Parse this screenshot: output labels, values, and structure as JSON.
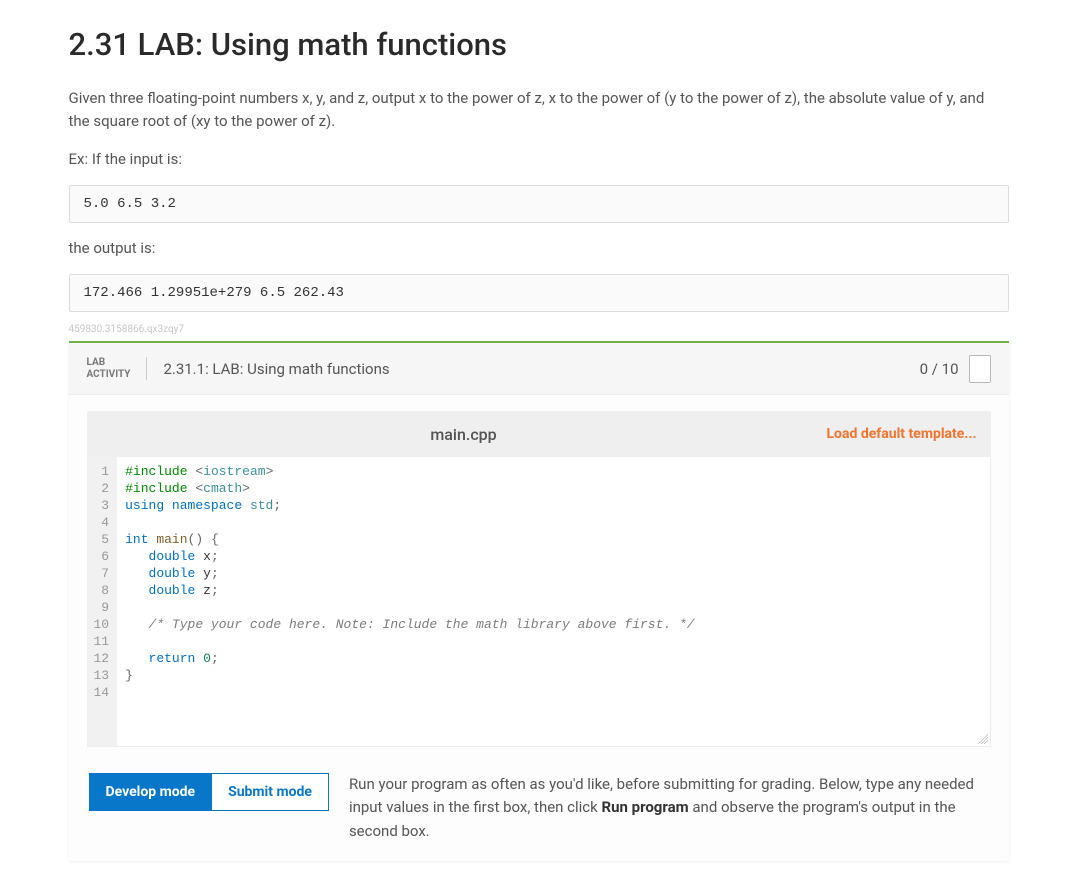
{
  "page": {
    "title": "2.31 LAB: Using math functions",
    "intro": "Given three floating-point numbers x, y, and z, output x to the power of z, x to the power of (y to the power of z), the absolute value of y, and the square root of (xy to the power of z).",
    "ex_label": "Ex: If the input is:",
    "ex_input": "5.0 6.5 3.2",
    "output_label": "the output is:",
    "ex_output": "172.466 1.29951e+279 6.5 262.43",
    "tiny_id": "459830.3158866.qx3zqy7"
  },
  "lab": {
    "activity_label_line1": "LAB",
    "activity_label_line2": "ACTIVITY",
    "title": "2.31.1: LAB: Using math functions",
    "score": "0 / 10",
    "filename": "main.cpp",
    "load_template": "Load default template...",
    "code_lines": [
      {
        "n": 1,
        "tokens": [
          [
            "kw-pre",
            "#include "
          ],
          [
            "punct",
            "<"
          ],
          [
            "id-ns",
            "iostream"
          ],
          [
            "punct",
            ">"
          ]
        ]
      },
      {
        "n": 2,
        "tokens": [
          [
            "kw-pre",
            "#include "
          ],
          [
            "punct",
            "<"
          ],
          [
            "id-ns",
            "cmath"
          ],
          [
            "punct",
            ">"
          ]
        ]
      },
      {
        "n": 3,
        "tokens": [
          [
            "kw",
            "using "
          ],
          [
            "kw2",
            "namespace "
          ],
          [
            "id-ns",
            "std"
          ],
          [
            "punct",
            ";"
          ]
        ]
      },
      {
        "n": 4,
        "tokens": []
      },
      {
        "n": 5,
        "tokens": [
          [
            "kw",
            "int "
          ],
          [
            "fn",
            "main"
          ],
          [
            "punct",
            "() {"
          ]
        ]
      },
      {
        "n": 6,
        "tokens": [
          [
            "",
            "   "
          ],
          [
            "type",
            "double "
          ],
          [
            "",
            "x"
          ],
          [
            "punct",
            ";"
          ]
        ]
      },
      {
        "n": 7,
        "tokens": [
          [
            "",
            "   "
          ],
          [
            "type",
            "double "
          ],
          [
            "",
            "y"
          ],
          [
            "punct",
            ";"
          ]
        ]
      },
      {
        "n": 8,
        "tokens": [
          [
            "",
            "   "
          ],
          [
            "type",
            "double "
          ],
          [
            "",
            "z"
          ],
          [
            "punct",
            ";"
          ]
        ]
      },
      {
        "n": 9,
        "tokens": []
      },
      {
        "n": 10,
        "tokens": [
          [
            "",
            "   "
          ],
          [
            "cmt",
            "/* Type your code here. Note: Include the math library above first. */"
          ]
        ]
      },
      {
        "n": 11,
        "tokens": []
      },
      {
        "n": 12,
        "tokens": [
          [
            "",
            "   "
          ],
          [
            "kw",
            "return "
          ],
          [
            "num",
            "0"
          ],
          [
            "punct",
            ";"
          ]
        ]
      },
      {
        "n": 13,
        "tokens": [
          [
            "punct",
            "}"
          ]
        ]
      },
      {
        "n": 14,
        "tokens": []
      }
    ],
    "mode": {
      "develop": "Develop mode",
      "submit": "Submit mode",
      "help_pre": "Run your program as often as you'd like, before submitting for grading. Below, type any needed input values in the first box, then click ",
      "help_bold": "Run program",
      "help_post": " and observe the program's output in the second box."
    }
  }
}
